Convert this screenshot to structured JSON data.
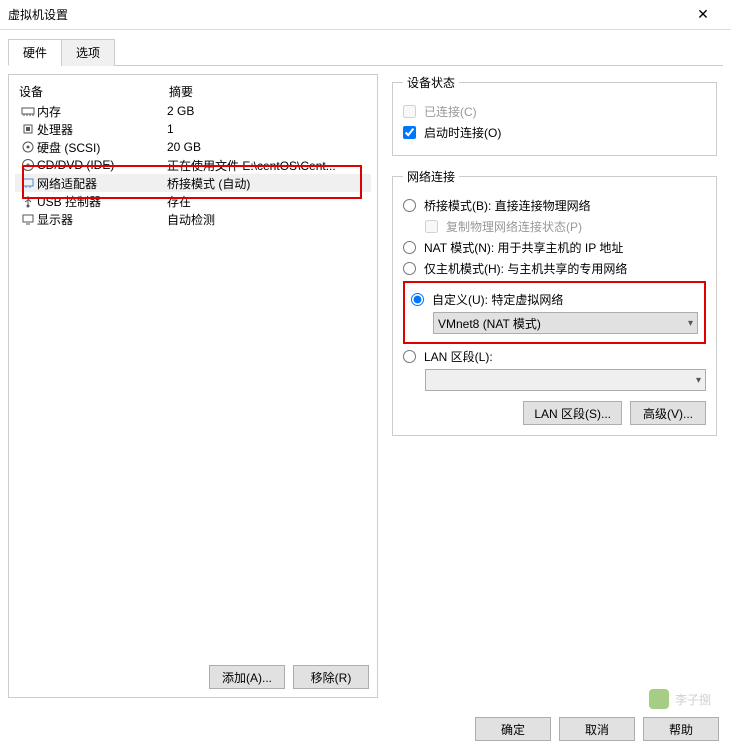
{
  "window": {
    "title": "虚拟机设置"
  },
  "tabs": {
    "hardware": "硬件",
    "options": "选项"
  },
  "hw": {
    "header_device": "设备",
    "header_summary": "摘要",
    "rows": [
      {
        "name": "内存",
        "summary": "2 GB"
      },
      {
        "name": "处理器",
        "summary": "1"
      },
      {
        "name": "硬盘 (SCSI)",
        "summary": "20 GB"
      },
      {
        "name": "CD/DVD (IDE)",
        "summary": "正在使用文件 E:\\centOS\\Cent..."
      },
      {
        "name": "网络适配器",
        "summary": "桥接模式 (自动)"
      },
      {
        "name": "USB 控制器",
        "summary": "存在"
      },
      {
        "name": "显示器",
        "summary": "自动检测"
      }
    ],
    "add_btn": "添加(A)...",
    "remove_btn": "移除(R)"
  },
  "status": {
    "legend": "设备状态",
    "connected": "已连接(C)",
    "connect_at_power": "启动时连接(O)"
  },
  "net": {
    "legend": "网络连接",
    "bridged": "桥接模式(B): 直接连接物理网络",
    "replicate": "复制物理网络连接状态(P)",
    "nat": "NAT 模式(N): 用于共享主机的 IP 地址",
    "hostonly": "仅主机模式(H): 与主机共享的专用网络",
    "custom": "自定义(U): 特定虚拟网络",
    "custom_value": "VMnet8 (NAT 模式)",
    "lanseg": "LAN 区段(L):",
    "lanseg_btn": "LAN 区段(S)...",
    "adv_btn": "高级(V)..."
  },
  "footer": {
    "ok": "确定",
    "cancel": "取消",
    "help": "帮助"
  },
  "watermark": "李子捌"
}
